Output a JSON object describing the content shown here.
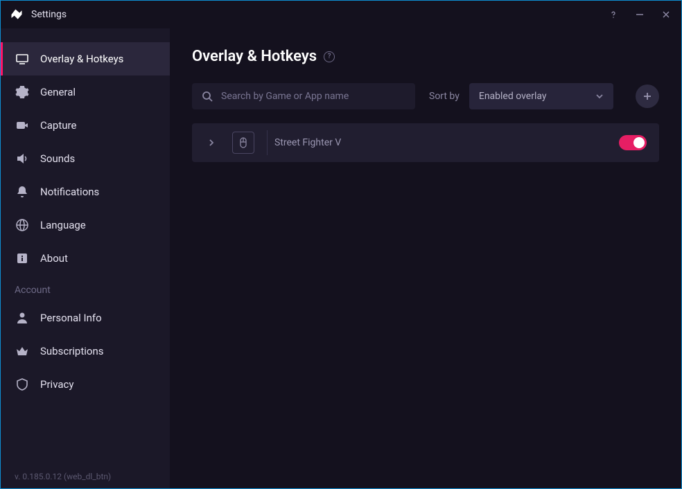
{
  "window": {
    "title": "Settings"
  },
  "sidebar": {
    "items": [
      {
        "id": "overlay",
        "label": "Overlay & Hotkeys",
        "active": true
      },
      {
        "id": "general",
        "label": "General"
      },
      {
        "id": "capture",
        "label": "Capture"
      },
      {
        "id": "sounds",
        "label": "Sounds"
      },
      {
        "id": "notifications",
        "label": "Notifications"
      },
      {
        "id": "language",
        "label": "Language"
      },
      {
        "id": "about",
        "label": "About"
      }
    ],
    "account_heading": "Account",
    "account_items": [
      {
        "id": "personal",
        "label": "Personal Info"
      },
      {
        "id": "subscriptions",
        "label": "Subscriptions"
      },
      {
        "id": "privacy",
        "label": "Privacy"
      }
    ],
    "version": "v. 0.185.0.12 (web_dl_btn)"
  },
  "page": {
    "title": "Overlay & Hotkeys"
  },
  "toolbar": {
    "search_placeholder": "Search by Game or App name",
    "sort_label": "Sort by",
    "sort_value": "Enabled overlay"
  },
  "games": [
    {
      "name": "Street Fighter V",
      "enabled": true
    }
  ]
}
